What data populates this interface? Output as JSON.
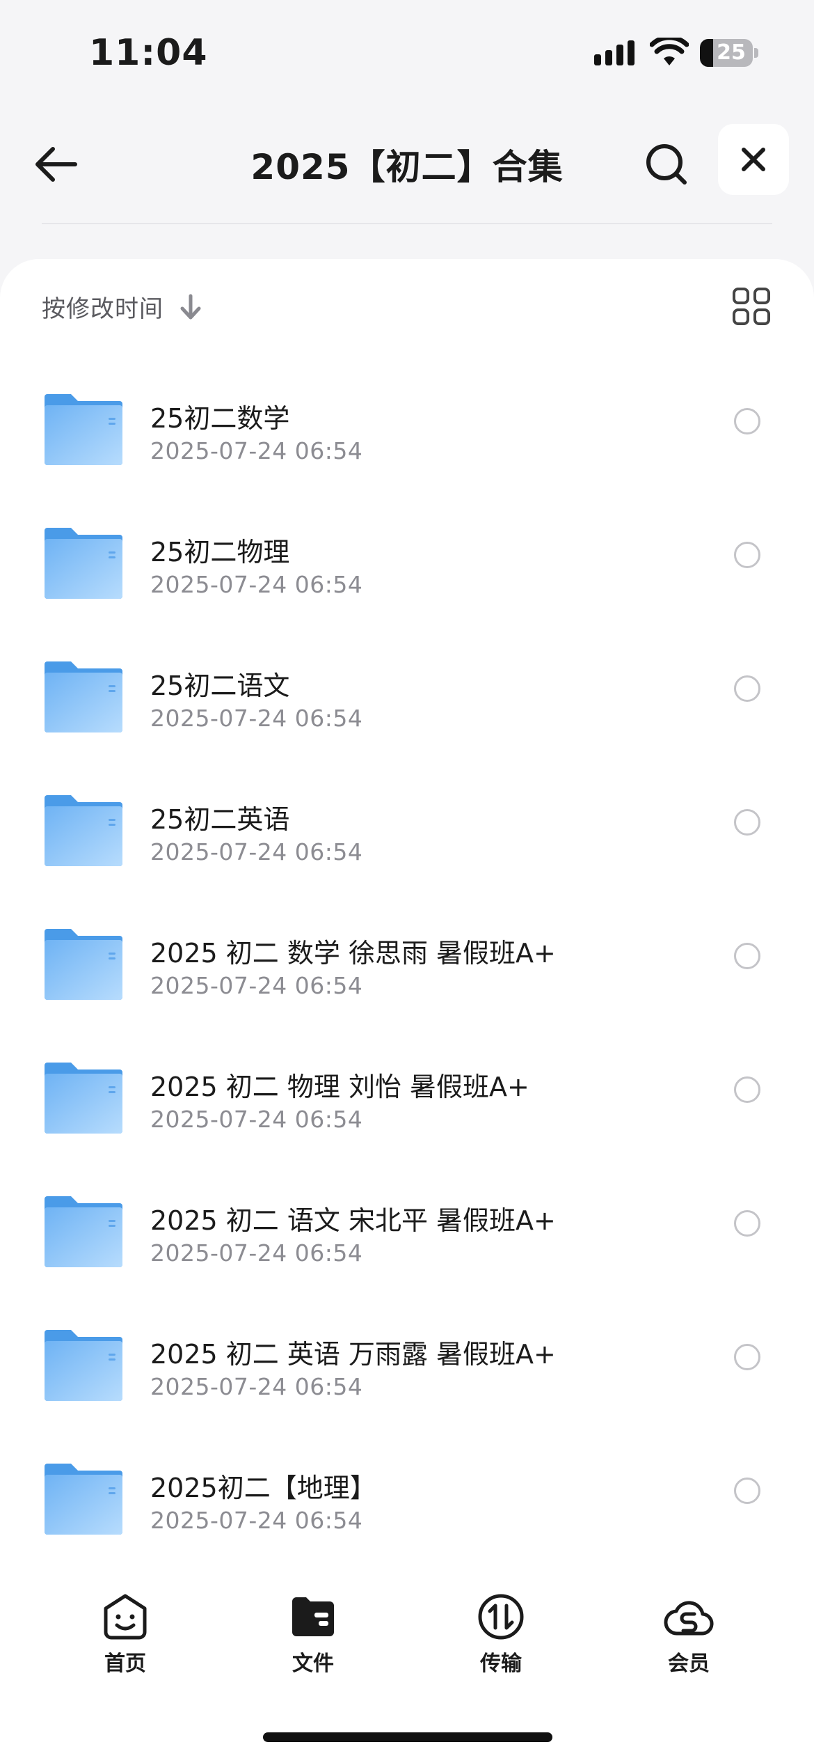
{
  "status_bar": {
    "time": "11:04",
    "battery_level": 25,
    "battery_label": "25"
  },
  "header": {
    "title": "2025【初二】合集"
  },
  "sort": {
    "label": "按修改时间"
  },
  "files": [
    {
      "name": "25初二数学",
      "modified": "2025-07-24 06:54"
    },
    {
      "name": "25初二物理",
      "modified": "2025-07-24 06:54"
    },
    {
      "name": "25初二语文",
      "modified": "2025-07-24 06:54"
    },
    {
      "name": "25初二英语",
      "modified": "2025-07-24 06:54"
    },
    {
      "name": "2025 初二 数学 徐思雨 暑假班A+",
      "modified": "2025-07-24 06:54"
    },
    {
      "name": "2025 初二 物理 刘怡 暑假班A+",
      "modified": "2025-07-24 06:54"
    },
    {
      "name": "2025 初二 语文 宋北平 暑假班A+",
      "modified": "2025-07-24 06:54"
    },
    {
      "name": "2025 初二 英语 万雨露 暑假班A+",
      "modified": "2025-07-24 06:54"
    },
    {
      "name": "2025初二【地理】",
      "modified": "2025-07-24 06:54"
    }
  ],
  "tabs": [
    {
      "label": "首页",
      "icon": "smile-bag-icon"
    },
    {
      "label": "文件",
      "icon": "folder-filled-icon",
      "active": true
    },
    {
      "label": "传输",
      "icon": "transfer-icon"
    },
    {
      "label": "会员",
      "icon": "cloud-s-icon"
    }
  ],
  "colors": {
    "folder_dark": "#4a9be8",
    "folder_light": "#a9d4fb",
    "background": "#f5f5f7"
  }
}
